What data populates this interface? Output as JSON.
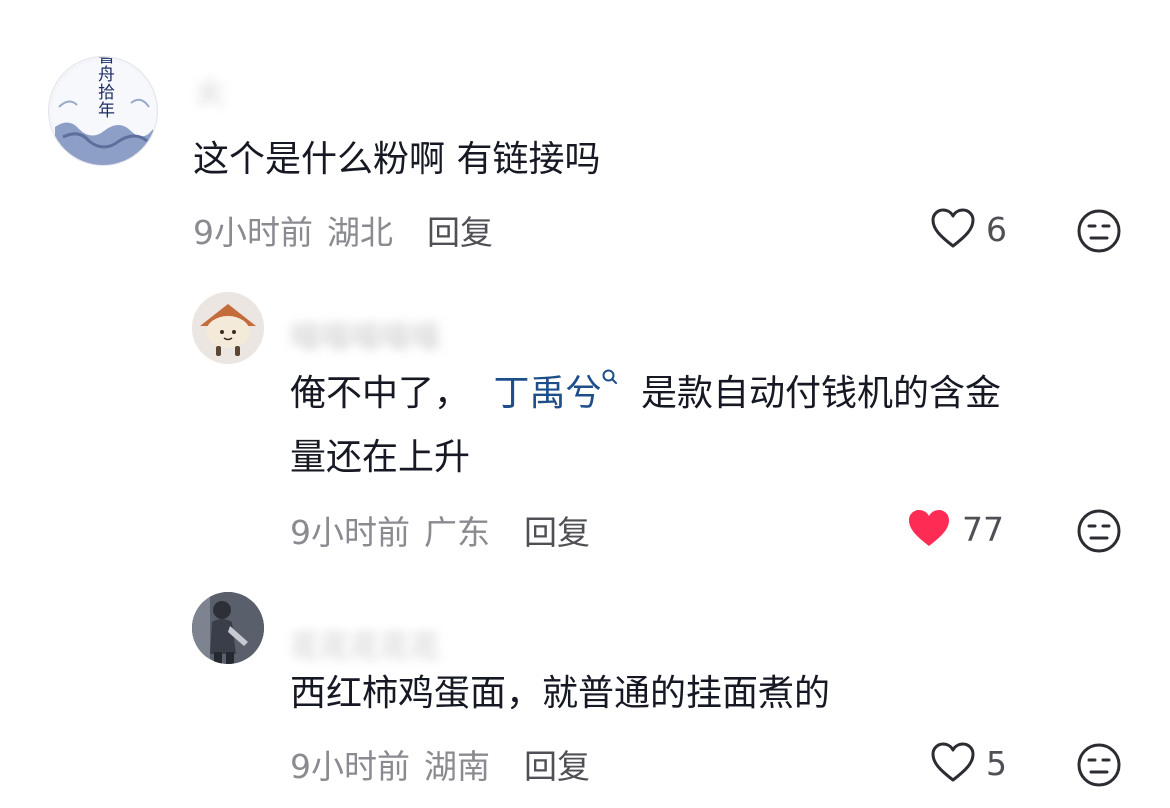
{
  "comments": [
    {
      "username": "火",
      "text": "这个是什么粉啊 有链接吗",
      "time": "9小时前",
      "region": "湖北",
      "reply_label": "回复",
      "likes": "6",
      "liked": false,
      "avatar_text": "書舟拾年"
    },
    {
      "username": "喵喵喵喵喵",
      "text_prefix": "俺不中了，",
      "mention": "丁禹兮",
      "text_suffix_line1": "是款自动付钱机的含金",
      "text_line2": "量还在上升",
      "time": "9小时前",
      "region": "广东",
      "reply_label": "回复",
      "likes": "77",
      "liked": true
    },
    {
      "username": "花花花花花",
      "text": "西红柿鸡蛋面，就普通的挂面煮的",
      "time": "9小时前",
      "region": "湖南",
      "reply_label": "回复",
      "likes": "5",
      "liked": false
    }
  ],
  "colors": {
    "text": "#161823",
    "meta": "#8a8b91",
    "mention": "#1d4e89",
    "liked_heart": "#fe2c55"
  },
  "icons": [
    "heart-outline-icon",
    "heart-filled-icon",
    "dislike-face-icon",
    "search-icon"
  ]
}
